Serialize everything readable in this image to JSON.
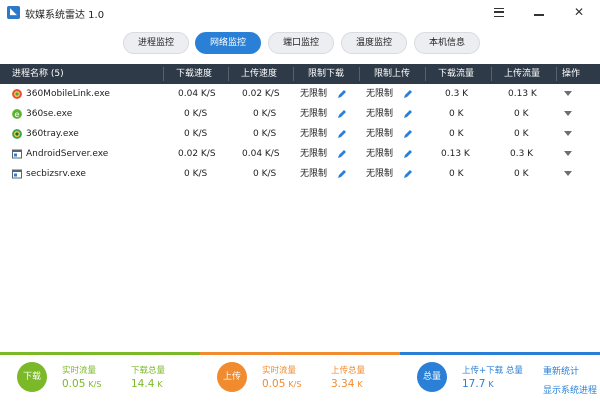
{
  "titlebar": {
    "title": "软媒系统雷达 1.0",
    "close_glyph": "✕"
  },
  "tabs": [
    {
      "label": "进程监控",
      "active": false
    },
    {
      "label": "网络监控",
      "active": true
    },
    {
      "label": "端口监控",
      "active": false
    },
    {
      "label": "温度监控",
      "active": false
    },
    {
      "label": "本机信息",
      "active": false
    }
  ],
  "table": {
    "headers": {
      "process": "进程名称 (5)",
      "download_speed": "下载速度",
      "upload_speed": "上传速度",
      "download_limit": "限制下载",
      "upload_limit": "限制上传",
      "download_traffic": "下载流量",
      "upload_traffic": "上传流量",
      "action": "操作"
    },
    "rows": [
      {
        "icon": "360-mobile-link-icon",
        "name": "360MobileLink.exe",
        "dl": "0.04 K/S",
        "ul": "0.02 K/S",
        "dl_limit": "无限制",
        "ul_limit": "无限制",
        "dl_traffic": "0.3 K",
        "ul_traffic": "0.13 K"
      },
      {
        "icon": "360se-icon",
        "name": "360se.exe",
        "dl": "0 K/S",
        "ul": "0 K/S",
        "dl_limit": "无限制",
        "ul_limit": "无限制",
        "dl_traffic": "0 K",
        "ul_traffic": "0 K"
      },
      {
        "icon": "360tray-icon",
        "name": "360tray.exe",
        "dl": "0 K/S",
        "ul": "0 K/S",
        "dl_limit": "无限制",
        "ul_limit": "无限制",
        "dl_traffic": "0 K",
        "ul_traffic": "0 K"
      },
      {
        "icon": "android-server-icon",
        "name": "AndroidServer.exe",
        "dl": "0.02 K/S",
        "ul": "0.04 K/S",
        "dl_limit": "无限制",
        "ul_limit": "无限制",
        "dl_traffic": "0.13 K",
        "ul_traffic": "0.3 K"
      },
      {
        "icon": "secbizsrv-icon",
        "name": "secbizsrv.exe",
        "dl": "0 K/S",
        "ul": "0 K/S",
        "dl_limit": "无限制",
        "ul_limit": "无限制",
        "dl_traffic": "0 K",
        "ul_traffic": "0 K"
      }
    ]
  },
  "footer": {
    "download": {
      "circle_label": "下载",
      "realtime_label": "实时流量",
      "realtime_value": "0.05",
      "realtime_unit": "K/S",
      "total_label": "下载总量",
      "total_value": "14.4",
      "total_unit": "K",
      "color": "#7bb928"
    },
    "upload": {
      "circle_label": "上传",
      "realtime_label": "实时流量",
      "realtime_value": "0.05",
      "realtime_unit": "K/S",
      "total_label": "上传总量",
      "total_value": "3.34",
      "total_unit": "K",
      "color": "#f08b2f"
    },
    "total": {
      "circle_label": "总量",
      "label": "上传+下载 总量",
      "value": "17.7",
      "unit": "K",
      "color": "#2a80d6"
    },
    "links": {
      "recount": "重新统计",
      "show_system": "显示系统进程"
    }
  }
}
